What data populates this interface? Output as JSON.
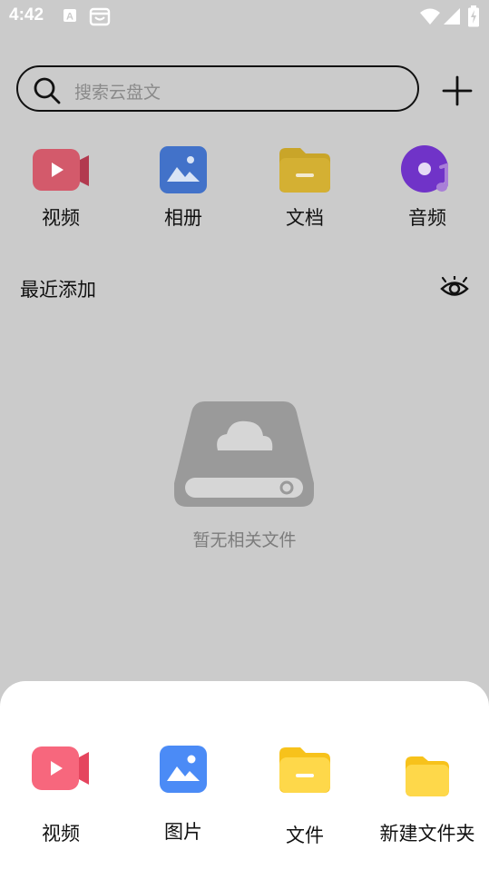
{
  "status": {
    "time": "4:42"
  },
  "search": {
    "placeholder": "搜索云盘文"
  },
  "categories": [
    {
      "label": "视频",
      "icon": "video-icon"
    },
    {
      "label": "相册",
      "icon": "photo-album-icon"
    },
    {
      "label": "文档",
      "icon": "document-folder-icon"
    },
    {
      "label": "音频",
      "icon": "audio-disc-icon"
    }
  ],
  "recent": {
    "title": "最近添加",
    "empty_text": "暂无相关文件"
  },
  "sheet": {
    "items": [
      {
        "label": "视频",
        "icon": "video-icon"
      },
      {
        "label": "图片",
        "icon": "image-icon"
      },
      {
        "label": "文件",
        "icon": "file-folder-icon"
      },
      {
        "label": "新建文件夹",
        "icon": "new-folder-icon"
      }
    ]
  },
  "colors": {
    "background": "#cbcbcb",
    "sheet": "#ffffff",
    "video": "#f0566e",
    "photo": "#4a8ef5",
    "folder": "#fdd23e",
    "audio": "#8b3ff0"
  }
}
